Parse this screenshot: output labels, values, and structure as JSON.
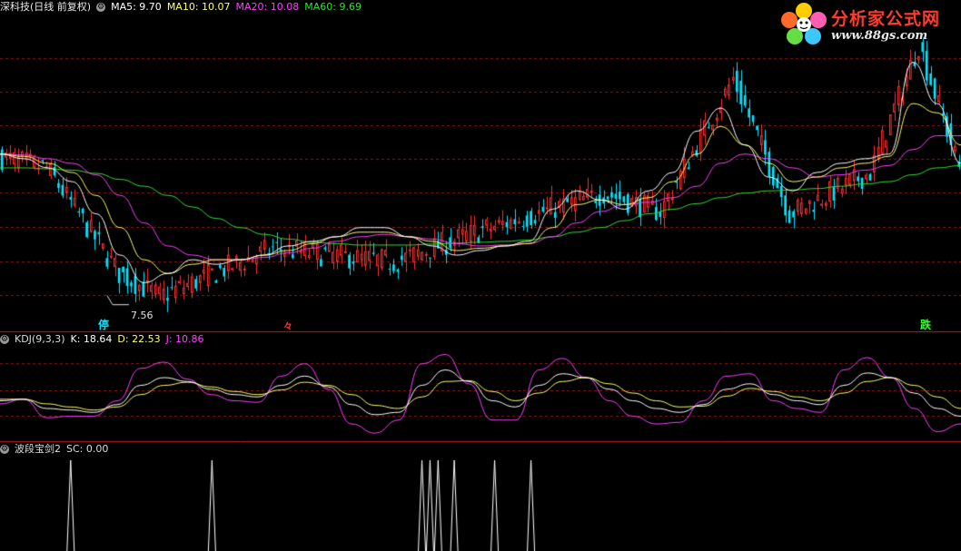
{
  "main_header": {
    "title": "深科技(日线 前复权)",
    "ma5": "MA5: 9.70",
    "ma10": "MA10: 10.07",
    "ma20": "MA20: 10.08",
    "ma60": "MA60: 9.69"
  },
  "kdj_header": {
    "title": "KDJ(9,3,3)",
    "k": "K: 18.64",
    "d": "D: 22.53",
    "j": "J: 10.86"
  },
  "sc_header": {
    "title": "波段宝剑2",
    "sc": "SC: 0.00"
  },
  "logo": {
    "text": "分析家公式网",
    "url": "www.88gs.com"
  },
  "annotations": {
    "low_price": "7.56",
    "signal_stop_left": "停",
    "signal_mid": "々",
    "signal_stop_right": "跌"
  },
  "colors": {
    "background": "#000000",
    "up": "#ff3030",
    "down": "#00e5ff",
    "ma5": "#ffffff",
    "ma10": "#ffff66",
    "ma20": "#ff40ff",
    "ma60": "#30e030",
    "kdj_k": "#ffffff",
    "kdj_d": "#ffff66",
    "kdj_j": "#ff40ff",
    "grid": "#8b1a1a",
    "panel_divider": "#c81e1e"
  },
  "chart_data": [
    {
      "type": "candlestick",
      "panel": "price",
      "ylim": [
        7.0,
        13.8
      ],
      "low_marker": 7.56,
      "candles": [
        {
          "n": 12,
          "o": 10.75,
          "c": 10.5,
          "drift": "down"
        },
        {
          "n": 18,
          "o": 10.5,
          "c": 8.2,
          "drift": "down"
        },
        {
          "n": 10,
          "o": 8.2,
          "c": 7.7,
          "drift": "down"
        },
        {
          "n": 28,
          "o": 7.7,
          "c": 8.75,
          "drift": "up"
        },
        {
          "n": 30,
          "o": 8.75,
          "c": 8.45,
          "drift": "flat"
        },
        {
          "n": 22,
          "o": 8.45,
          "c": 9.15,
          "drift": "up"
        },
        {
          "n": 30,
          "o": 9.15,
          "c": 9.95,
          "drift": "up"
        },
        {
          "n": 14,
          "o": 9.95,
          "c": 9.55,
          "drift": "down"
        },
        {
          "n": 18,
          "o": 9.55,
          "c": 12.45,
          "drift": "up"
        },
        {
          "n": 14,
          "o": 12.45,
          "c": 9.5,
          "drift": "down"
        },
        {
          "n": 20,
          "o": 9.5,
          "c": 10.4,
          "drift": "up"
        },
        {
          "n": 12,
          "o": 10.4,
          "c": 13.2,
          "drift": "up"
        },
        {
          "n": 10,
          "o": 13.2,
          "c": 10.5,
          "drift": "down"
        }
      ],
      "series": [
        {
          "name": "MA5",
          "values": [
            10.8,
            10.7,
            10.5,
            10.2,
            9.5,
            8.6,
            8.0,
            8.2,
            8.5,
            8.4,
            8.5,
            8.6,
            8.8,
            8.9,
            9.0,
            9.2,
            9.2,
            9.0,
            8.8,
            8.6,
            8.7,
            8.8,
            8.9,
            9.6,
            10.0,
            9.8,
            9.6,
            10.0,
            10.4,
            11.3,
            11.8,
            11.0,
            10.3,
            10.0,
            10.4,
            10.6,
            10.7,
            10.8,
            12.8,
            11.9,
            10.6
          ]
        },
        {
          "name": "MA10",
          "values": [
            10.8,
            10.75,
            10.6,
            10.4,
            9.9,
            9.2,
            8.5,
            8.2,
            8.4,
            8.5,
            8.5,
            8.6,
            8.7,
            8.85,
            9.0,
            9.1,
            9.1,
            9.0,
            8.9,
            8.7,
            8.75,
            8.8,
            8.85,
            9.2,
            9.7,
            9.8,
            9.7,
            9.85,
            10.2,
            10.8,
            11.4,
            11.0,
            10.6,
            10.2,
            10.3,
            10.5,
            10.6,
            10.75,
            11.9,
            11.7,
            11.0
          ]
        },
        {
          "name": "MA20",
          "values": [
            10.8,
            10.78,
            10.7,
            10.6,
            10.35,
            9.9,
            9.3,
            8.8,
            8.6,
            8.5,
            8.5,
            8.55,
            8.65,
            8.75,
            8.9,
            9.0,
            9.05,
            9.0,
            8.95,
            8.85,
            8.8,
            8.82,
            8.85,
            9.0,
            9.3,
            9.55,
            9.7,
            9.75,
            9.85,
            10.1,
            10.6,
            10.8,
            10.7,
            10.5,
            10.3,
            10.35,
            10.45,
            10.55,
            10.9,
            11.2,
            11.2
          ]
        },
        {
          "name": "MA60",
          "values": [
            10.5,
            10.5,
            10.48,
            10.45,
            10.38,
            10.25,
            10.1,
            9.9,
            9.65,
            9.4,
            9.2,
            9.05,
            8.95,
            8.88,
            8.85,
            8.82,
            8.82,
            8.82,
            8.84,
            8.86,
            8.88,
            8.9,
            8.93,
            9.0,
            9.1,
            9.2,
            9.35,
            9.5,
            9.6,
            9.72,
            9.85,
            9.95,
            10.0,
            10.02,
            10.05,
            10.1,
            10.15,
            10.2,
            10.35,
            10.5,
            10.55
          ]
        }
      ]
    },
    {
      "type": "line",
      "panel": "kdj",
      "ylim": [
        -10,
        110
      ],
      "series": [
        {
          "name": "K",
          "values": [
            40,
            42,
            30,
            28,
            25,
            35,
            60,
            70,
            65,
            55,
            48,
            45,
            60,
            72,
            58,
            35,
            22,
            25,
            60,
            80,
            65,
            40,
            32,
            60,
            75,
            70,
            55,
            40,
            30,
            25,
            35,
            55,
            62,
            48,
            40,
            35,
            60,
            76,
            70,
            50,
            30,
            20
          ]
        },
        {
          "name": "D",
          "values": [
            42,
            42,
            36,
            32,
            28,
            32,
            48,
            60,
            64,
            58,
            52,
            48,
            54,
            64,
            60,
            48,
            34,
            30,
            45,
            65,
            66,
            52,
            40,
            50,
            65,
            70,
            62,
            50,
            40,
            32,
            33,
            46,
            56,
            52,
            45,
            40,
            50,
            65,
            70,
            60,
            45,
            30
          ]
        },
        {
          "name": "J",
          "values": [
            36,
            42,
            18,
            20,
            20,
            40,
            82,
            90,
            68,
            48,
            40,
            38,
            72,
            88,
            55,
            10,
            -2,
            15,
            88,
            100,
            62,
            15,
            15,
            80,
            95,
            70,
            40,
            20,
            10,
            12,
            40,
            72,
            75,
            40,
            30,
            25,
            80,
            96,
            70,
            30,
            0,
            10
          ]
        }
      ]
    },
    {
      "type": "spike",
      "panel": "sc",
      "ylim": [
        0,
        1
      ],
      "series": [
        {
          "name": "SC",
          "values": [
            0,
            0,
            0,
            0,
            0,
            0,
            0,
            0,
            0,
            0,
            0,
            0,
            0,
            0,
            0,
            0,
            0,
            0,
            0,
            0,
            0,
            0,
            0,
            0,
            0,
            0,
            0,
            0,
            0,
            0,
            0,
            0,
            0,
            0,
            0,
            0,
            0,
            0,
            0,
            0,
            0,
            0
          ]
        }
      ],
      "spike_bars": [
        17,
        52,
        104,
        106,
        108,
        112,
        122,
        131
      ]
    }
  ]
}
